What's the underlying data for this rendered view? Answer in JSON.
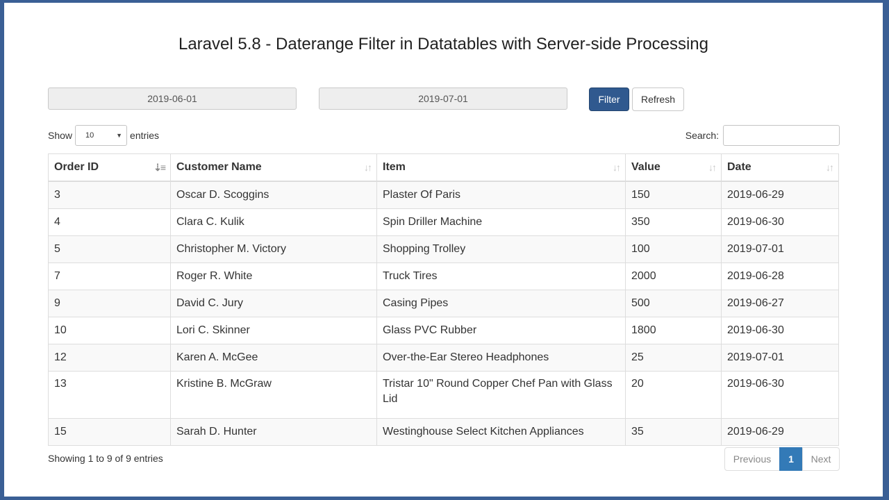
{
  "page": {
    "title": "Laravel 5.8 - Daterange Filter in Datatables with Server-side Processing"
  },
  "filters": {
    "from_date": "2019-06-01",
    "to_date": "2019-07-01",
    "filter_label": "Filter",
    "refresh_label": "Refresh"
  },
  "length": {
    "show_label": "Show",
    "selected": "10",
    "entries_label": "entries"
  },
  "search": {
    "label": "Search:",
    "value": ""
  },
  "table": {
    "columns": [
      "Order ID",
      "Customer Name",
      "Item",
      "Value",
      "Date"
    ],
    "rows": [
      [
        "3",
        "Oscar D. Scoggins",
        "Plaster Of Paris",
        "150",
        "2019-06-29"
      ],
      [
        "4",
        "Clara C. Kulik",
        "Spin Driller Machine",
        "350",
        "2019-06-30"
      ],
      [
        "5",
        "Christopher M. Victory",
        "Shopping Trolley",
        "100",
        "2019-07-01"
      ],
      [
        "7",
        "Roger R. White",
        "Truck Tires",
        "2000",
        "2019-06-28"
      ],
      [
        "9",
        "David C. Jury",
        "Casing Pipes",
        "500",
        "2019-06-27"
      ],
      [
        "10",
        "Lori C. Skinner",
        "Glass PVC Rubber",
        "1800",
        "2019-06-30"
      ],
      [
        "12",
        "Karen A. McGee",
        "Over-the-Ear Stereo Headphones",
        "25",
        "2019-07-01"
      ],
      [
        "13",
        "Kristine B. McGraw",
        "Tristar 10\" Round Copper Chef Pan with Glass Lid",
        "20",
        "2019-06-30"
      ],
      [
        "15",
        "Sarah D. Hunter",
        "Westinghouse Select Kitchen Appliances",
        "35",
        "2019-06-29"
      ]
    ]
  },
  "info": "Showing 1 to 9 of 9 entries",
  "pagination": {
    "previous": "Previous",
    "current": "1",
    "next": "Next"
  }
}
